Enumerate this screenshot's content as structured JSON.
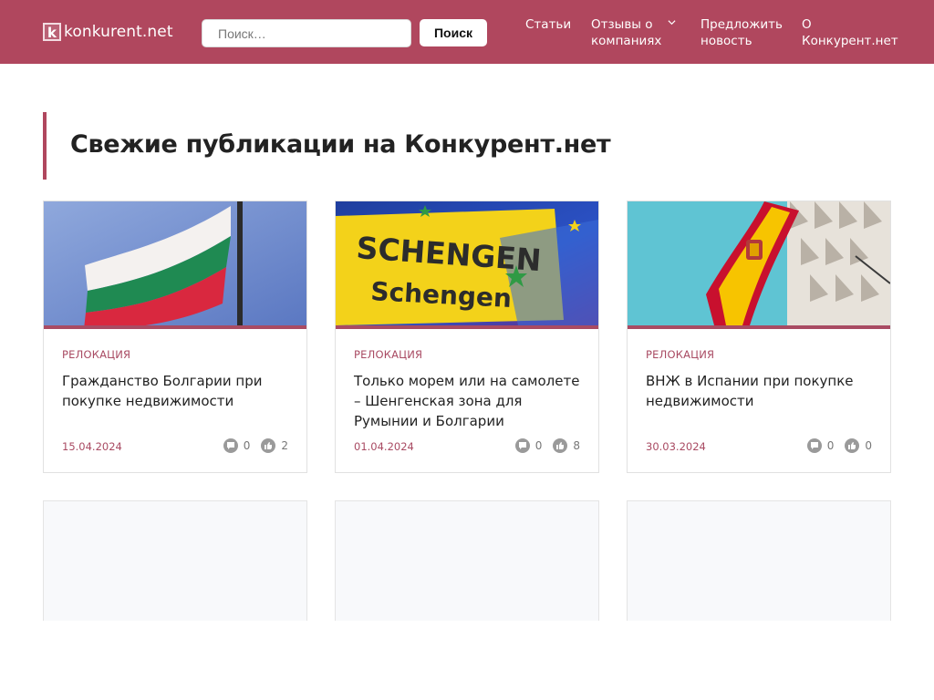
{
  "header": {
    "logo_letter": "k",
    "logo_text": "konkurent.net",
    "search_placeholder": "Поиск…",
    "search_button": "Поиск",
    "nav": {
      "articles": "Статьи",
      "reviews_line1": "Отзывы о",
      "reviews_line2": "компаниях",
      "suggest_line1": "Предложить",
      "suggest_line2": "новость",
      "about_line1": "О",
      "about_line2": "Конкурент.нет"
    },
    "brand_color": "#b0475e"
  },
  "main": {
    "title": "Свежие публикации на Конкурент.нет",
    "cards": [
      {
        "image": "bulgarian-flag",
        "category": "РЕЛОКАЦИЯ",
        "title": "Гражданство Болгарии при покупке недвижимости",
        "date": "15.04.2024",
        "comments": "0",
        "likes": "2"
      },
      {
        "image": "schengen-sign",
        "category": "РЕЛОКАЦИЯ",
        "title": "Только морем или на самолете – Шенгенская зона для Румынии и Болгарии",
        "date": "01.04.2024",
        "comments": "0",
        "likes": "8"
      },
      {
        "image": "spanish-flag",
        "category": "РЕЛОКАЦИЯ",
        "title": "ВНЖ в Испании при покупке недвижимости",
        "date": "30.03.2024",
        "comments": "0",
        "likes": "0"
      }
    ]
  },
  "icons": {
    "comment": "comment-icon",
    "like": "thumbs-up-icon",
    "dropdown": "chevron-down-icon"
  }
}
